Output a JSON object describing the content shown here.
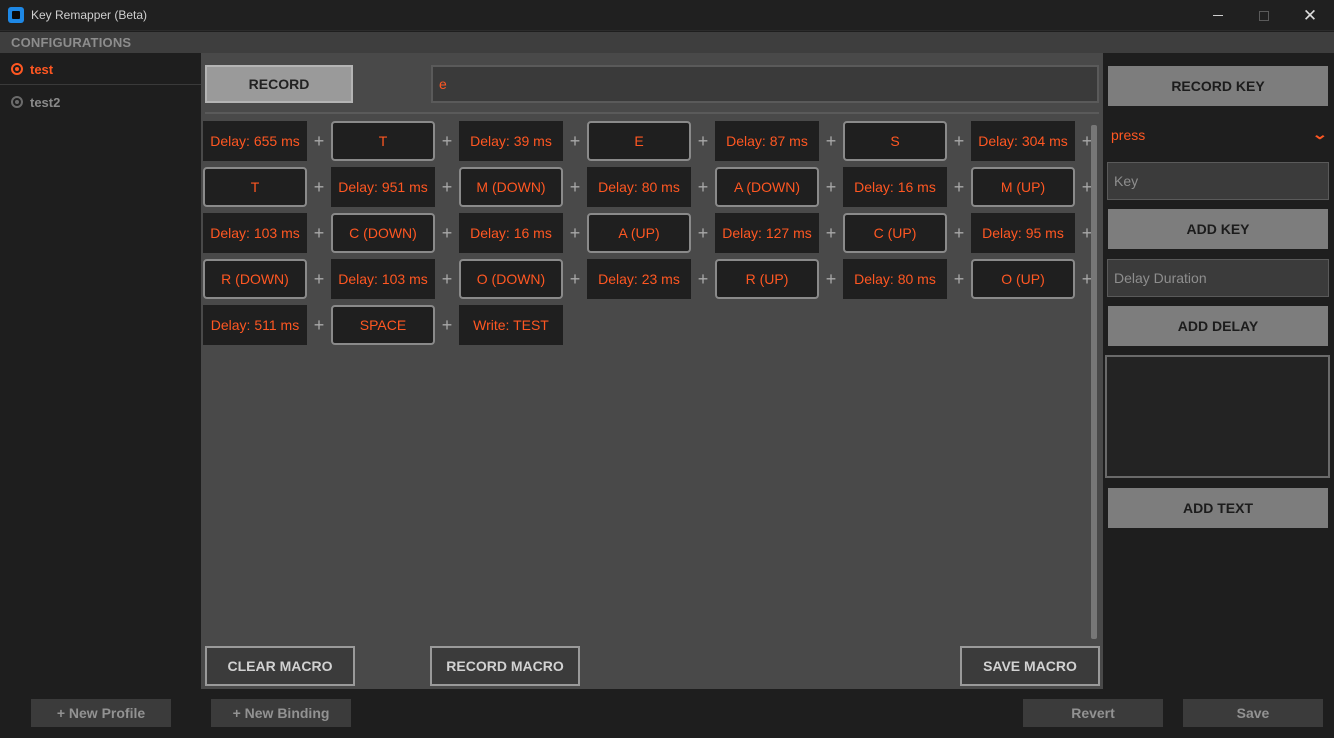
{
  "window": {
    "title": "Key Remapper (Beta)"
  },
  "configurations": {
    "header": "CONFIGURATIONS",
    "profiles": [
      {
        "label": "test",
        "selected": true
      },
      {
        "label": "test2",
        "selected": false
      }
    ]
  },
  "main": {
    "record_button": "RECORD",
    "record_value": "e",
    "macro_steps": [
      {
        "type": "delay",
        "label": "Delay: 655 ms"
      },
      {
        "type": "key",
        "label": "T"
      },
      {
        "type": "delay",
        "label": "Delay: 39 ms"
      },
      {
        "type": "key",
        "label": "E"
      },
      {
        "type": "delay",
        "label": "Delay: 87 ms"
      },
      {
        "type": "key",
        "label": "S"
      },
      {
        "type": "delay",
        "label": "Delay: 304 ms"
      },
      {
        "type": "key",
        "label": "T"
      },
      {
        "type": "delay",
        "label": "Delay: 951 ms"
      },
      {
        "type": "key",
        "label": "M (DOWN)"
      },
      {
        "type": "delay",
        "label": "Delay: 80 ms"
      },
      {
        "type": "key",
        "label": "A (DOWN)"
      },
      {
        "type": "delay",
        "label": "Delay: 16 ms"
      },
      {
        "type": "key",
        "label": "M (UP)"
      },
      {
        "type": "delay",
        "label": "Delay: 103 ms"
      },
      {
        "type": "key",
        "label": "C (DOWN)"
      },
      {
        "type": "delay",
        "label": "Delay: 16 ms"
      },
      {
        "type": "key",
        "label": "A (UP)"
      },
      {
        "type": "delay",
        "label": "Delay: 127 ms"
      },
      {
        "type": "key",
        "label": "C (UP)"
      },
      {
        "type": "delay",
        "label": "Delay: 95 ms"
      },
      {
        "type": "key",
        "label": "R (DOWN)"
      },
      {
        "type": "delay",
        "label": "Delay: 103 ms"
      },
      {
        "type": "key",
        "label": "O (DOWN)"
      },
      {
        "type": "delay",
        "label": "Delay: 23 ms"
      },
      {
        "type": "key",
        "label": "R (UP)"
      },
      {
        "type": "delay",
        "label": "Delay: 80 ms"
      },
      {
        "type": "key",
        "label": "O (UP)"
      },
      {
        "type": "delay",
        "label": "Delay: 511 ms"
      },
      {
        "type": "key",
        "label": "SPACE"
      },
      {
        "type": "delay",
        "label": "Write: TEST"
      }
    ],
    "plus_symbol": "+",
    "clear_macro": "CLEAR MACRO",
    "record_macro": "RECORD MACRO",
    "save_macro": "SAVE MACRO"
  },
  "right_panel": {
    "record_key": "RECORD KEY",
    "mode_select": "press",
    "key_placeholder": "Key",
    "add_key": "ADD KEY",
    "delay_placeholder": "Delay Duration",
    "add_delay": "ADD DELAY",
    "add_text": "ADD TEXT"
  },
  "footer": {
    "new_profile": "+ New Profile",
    "new_binding": "+ New Binding",
    "revert": "Revert",
    "save": "Save"
  },
  "colors": {
    "accent": "#ff5722",
    "background": "#1e1e1e",
    "panel": "#494949"
  },
  "icons": {
    "app": "app-icon",
    "close": "close-icon",
    "chevron": "chevron-down-icon"
  }
}
